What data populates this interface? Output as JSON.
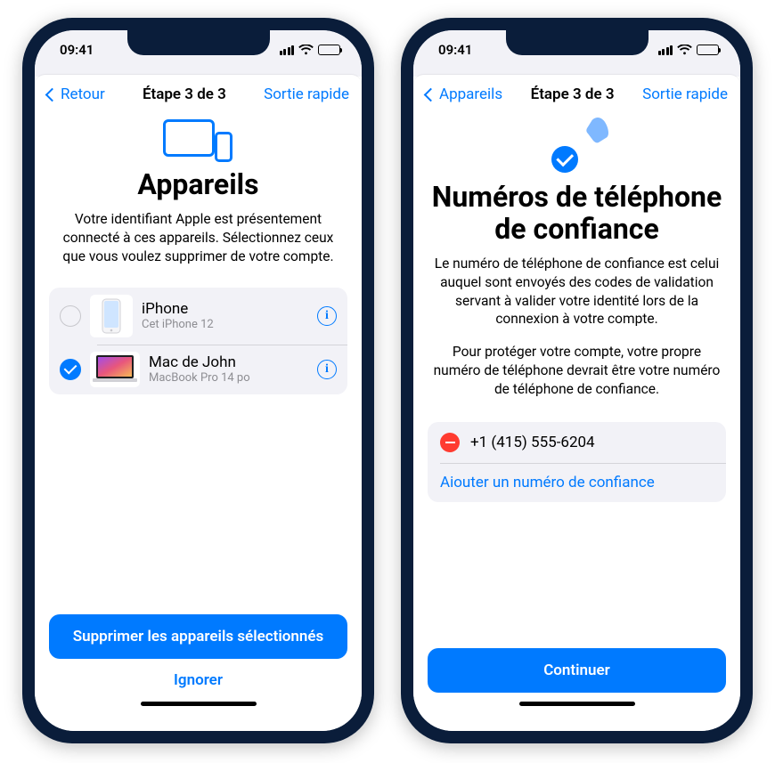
{
  "status": {
    "time": "09:41"
  },
  "phone1": {
    "nav": {
      "back": "Retour",
      "title": "Étape 3 de 3",
      "quick": "Sortie rapide"
    },
    "hero": {
      "title": "Appareils",
      "body": "Votre identifiant Apple est présentement connecté à ces appareils. Sélectionnez ceux que vous voulez supprimer de votre compte."
    },
    "devices": [
      {
        "name": "iPhone",
        "sub": "Cet iPhone 12",
        "checked": false
      },
      {
        "name": "Mac de John",
        "sub": "MacBook Pro 14 po",
        "checked": true
      }
    ],
    "footer": {
      "primary": "Supprimer les appareils sélectionnés",
      "secondary": "Ignorer"
    }
  },
  "phone2": {
    "nav": {
      "back": "Appareils",
      "title": "Étape 3 de 3",
      "quick": "Sortie rapide"
    },
    "hero": {
      "title": "Numéros de téléphone de confiance",
      "body1": "Le numéro de téléphone de confiance est celui auquel sont envoyés des codes de validation servant à valider votre identité lors de la connexion à votre compte.",
      "body2": "Pour protéger votre compte, votre propre numéro de téléphone devrait être votre numéro de téléphone de confiance."
    },
    "numbers": [
      {
        "value": "+1 (415) 555-6204"
      }
    ],
    "add_label": "Aiouter un numéro de confiance",
    "footer": {
      "primary": "Continuer"
    }
  }
}
